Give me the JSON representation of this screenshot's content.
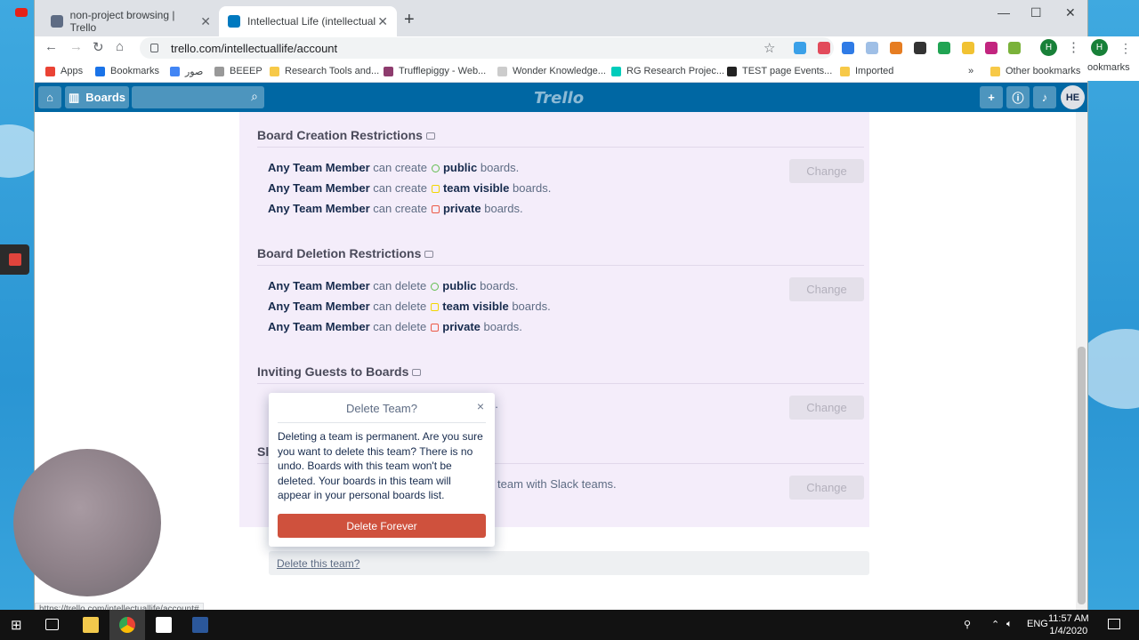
{
  "browser": {
    "tabs": [
      {
        "title": "non-project browsing | Trello"
      },
      {
        "title": "Intellectual Life (intellectuallife) |"
      }
    ],
    "url": "trello.com/intellectuallife/account",
    "bookmarks": [
      "Apps",
      "Bookmarks",
      "صور",
      "BEEEP",
      "Research Tools and...",
      "Trufflepiggy - Web...",
      "Wonder Knowledge...",
      "RG Research Projec...",
      "TEST page Events...",
      "Imported",
      "Other bookmarks"
    ],
    "right_bookmark": "ookmarks",
    "status_url": "https://trello.com/intellectuallife/account#"
  },
  "header": {
    "boards_label": "Boards",
    "logo": "Trello",
    "avatar_initials": "HE"
  },
  "sections": {
    "creation": {
      "title": "Board Creation Restrictions",
      "who": "Any Team Member",
      "verb": "can create",
      "items": [
        "public",
        "team visible",
        "private"
      ],
      "suffix": "boards.",
      "button": "Change"
    },
    "deletion": {
      "title": "Board Deletion Restrictions",
      "who": "Any Team Member",
      "verb": "can delete",
      "items": [
        "public",
        "team visible",
        "private"
      ],
      "suffix": "boards.",
      "button": "Change"
    },
    "guests": {
      "title": "Inviting Guests to Boards",
      "partial_text": "n.",
      "button": "Change"
    },
    "slack": {
      "title_partial": "Sla",
      "partial_text": "team with Slack teams.",
      "button": "Change"
    }
  },
  "delete_link": "Delete this team?",
  "popover": {
    "title": "Delete Team?",
    "close": "×",
    "body": "Deleting a team is permanent. Are you sure you want to delete this team? There is no undo. Boards with this team won't be deleted. Your boards in this team will appear in your personal boards list.",
    "button": "Delete Forever"
  },
  "taskbar": {
    "lang": "ENG",
    "time": "11:57 AM",
    "date": "1/4/2020"
  },
  "colors": {
    "trello_header": "#0067a3",
    "danger": "#cf513d",
    "panel_bg": "#f4edfa"
  }
}
